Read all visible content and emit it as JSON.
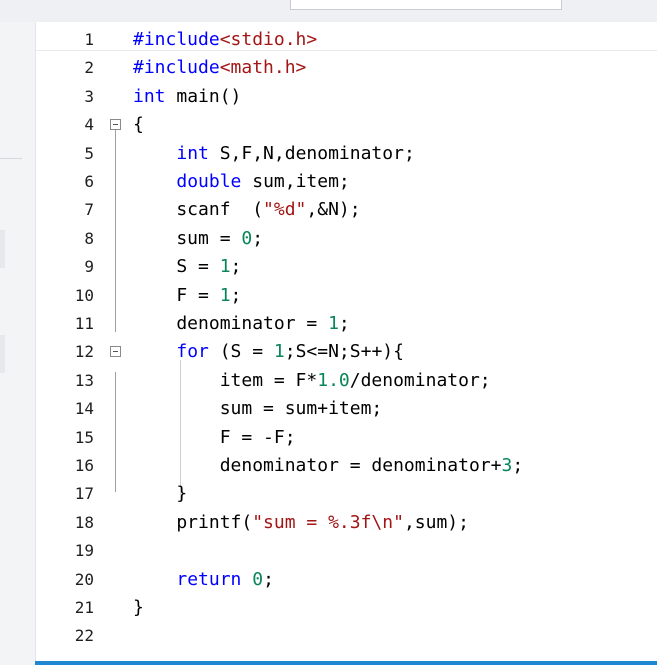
{
  "colors": {
    "keyword": "#0000ff",
    "string": "#a31515",
    "number": "#098658",
    "plain": "#000000",
    "line_number": "#1f1f1f",
    "status_bar": "#1f86d1"
  },
  "icons": {
    "fold": "collapse-box-icon"
  },
  "editor": {
    "lines": [
      {
        "num": "1",
        "tokens": [
          {
            "t": "#include",
            "c": "keyword"
          },
          {
            "t": "<stdio.h>",
            "c": "string"
          }
        ]
      },
      {
        "num": "2",
        "tokens": [
          {
            "t": "#include",
            "c": "keyword"
          },
          {
            "t": "<math.h>",
            "c": "string"
          }
        ]
      },
      {
        "num": "3",
        "tokens": [
          {
            "t": "int",
            "c": "keyword"
          },
          {
            "t": " main()",
            "c": "plain"
          }
        ]
      },
      {
        "num": "4",
        "fold": true,
        "tokens": [
          {
            "t": "{",
            "c": "plain"
          }
        ]
      },
      {
        "num": "5",
        "tokens": [
          {
            "t": "    ",
            "c": "plain"
          },
          {
            "t": "int",
            "c": "keyword"
          },
          {
            "t": " S,F,N,denominator;",
            "c": "plain"
          }
        ]
      },
      {
        "num": "6",
        "tokens": [
          {
            "t": "    ",
            "c": "plain"
          },
          {
            "t": "double",
            "c": "keyword"
          },
          {
            "t": " sum,item;",
            "c": "plain"
          }
        ]
      },
      {
        "num": "7",
        "tokens": [
          {
            "t": "    scanf  (",
            "c": "plain"
          },
          {
            "t": "\"%d\"",
            "c": "string"
          },
          {
            "t": ",&N);",
            "c": "plain"
          }
        ]
      },
      {
        "num": "8",
        "tokens": [
          {
            "t": "    sum = ",
            "c": "plain"
          },
          {
            "t": "0",
            "c": "number"
          },
          {
            "t": ";",
            "c": "plain"
          }
        ]
      },
      {
        "num": "9",
        "tokens": [
          {
            "t": "    S = ",
            "c": "plain"
          },
          {
            "t": "1",
            "c": "number"
          },
          {
            "t": ";",
            "c": "plain"
          }
        ]
      },
      {
        "num": "10",
        "tokens": [
          {
            "t": "    F = ",
            "c": "plain"
          },
          {
            "t": "1",
            "c": "number"
          },
          {
            "t": ";",
            "c": "plain"
          }
        ]
      },
      {
        "num": "11",
        "tokens": [
          {
            "t": "    denominator = ",
            "c": "plain"
          },
          {
            "t": "1",
            "c": "number"
          },
          {
            "t": ";",
            "c": "plain"
          }
        ]
      },
      {
        "num": "12",
        "fold": true,
        "tokens": [
          {
            "t": "    ",
            "c": "plain"
          },
          {
            "t": "for",
            "c": "keyword"
          },
          {
            "t": " (S = ",
            "c": "plain"
          },
          {
            "t": "1",
            "c": "number"
          },
          {
            "t": ";S<=N;S++){",
            "c": "plain"
          }
        ]
      },
      {
        "num": "13",
        "tokens": [
          {
            "t": "        item = F*",
            "c": "plain"
          },
          {
            "t": "1.0",
            "c": "number"
          },
          {
            "t": "/denominator;",
            "c": "plain"
          }
        ]
      },
      {
        "num": "14",
        "tokens": [
          {
            "t": "        sum = sum+item;",
            "c": "plain"
          }
        ]
      },
      {
        "num": "15",
        "tokens": [
          {
            "t": "        F = -F;",
            "c": "plain"
          }
        ]
      },
      {
        "num": "16",
        "tokens": [
          {
            "t": "        denominator = denominator+",
            "c": "plain"
          },
          {
            "t": "3",
            "c": "number"
          },
          {
            "t": ";",
            "c": "plain"
          }
        ]
      },
      {
        "num": "17",
        "tokens": [
          {
            "t": "    }",
            "c": "plain"
          }
        ]
      },
      {
        "num": "18",
        "tokens": [
          {
            "t": "    printf(",
            "c": "plain"
          },
          {
            "t": "\"sum = %.3f\\n\"",
            "c": "string"
          },
          {
            "t": ",sum);",
            "c": "plain"
          }
        ]
      },
      {
        "num": "19",
        "tokens": []
      },
      {
        "num": "20",
        "tokens": [
          {
            "t": "    ",
            "c": "plain"
          },
          {
            "t": "return",
            "c": "keyword"
          },
          {
            "t": " ",
            "c": "plain"
          },
          {
            "t": "0",
            "c": "number"
          },
          {
            "t": ";",
            "c": "plain"
          }
        ]
      },
      {
        "num": "21",
        "tokens": [
          {
            "t": "}",
            "c": "plain"
          }
        ]
      },
      {
        "num": "22",
        "tokens": []
      }
    ]
  }
}
